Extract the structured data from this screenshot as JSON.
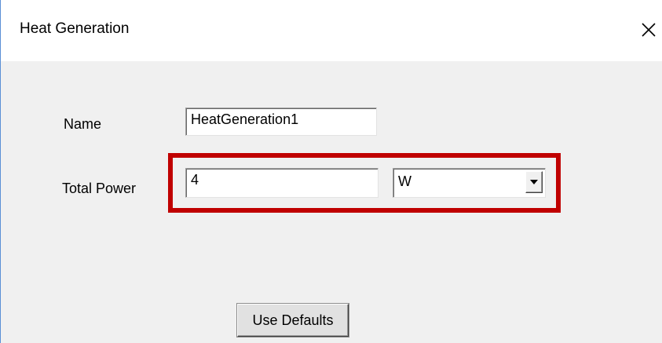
{
  "window": {
    "title": "Heat Generation"
  },
  "form": {
    "name_label": "Name",
    "name_value": "HeatGeneration1",
    "power_label": "Total Power",
    "power_value": "4",
    "unit_value": "W"
  },
  "buttons": {
    "use_defaults": "Use Defaults"
  },
  "icons": {
    "close": "close-icon",
    "dropdown": "chevron-down-icon"
  },
  "colors": {
    "highlight": "#c00000",
    "background": "#f0f0f0",
    "titlebar": "#ffffff"
  }
}
